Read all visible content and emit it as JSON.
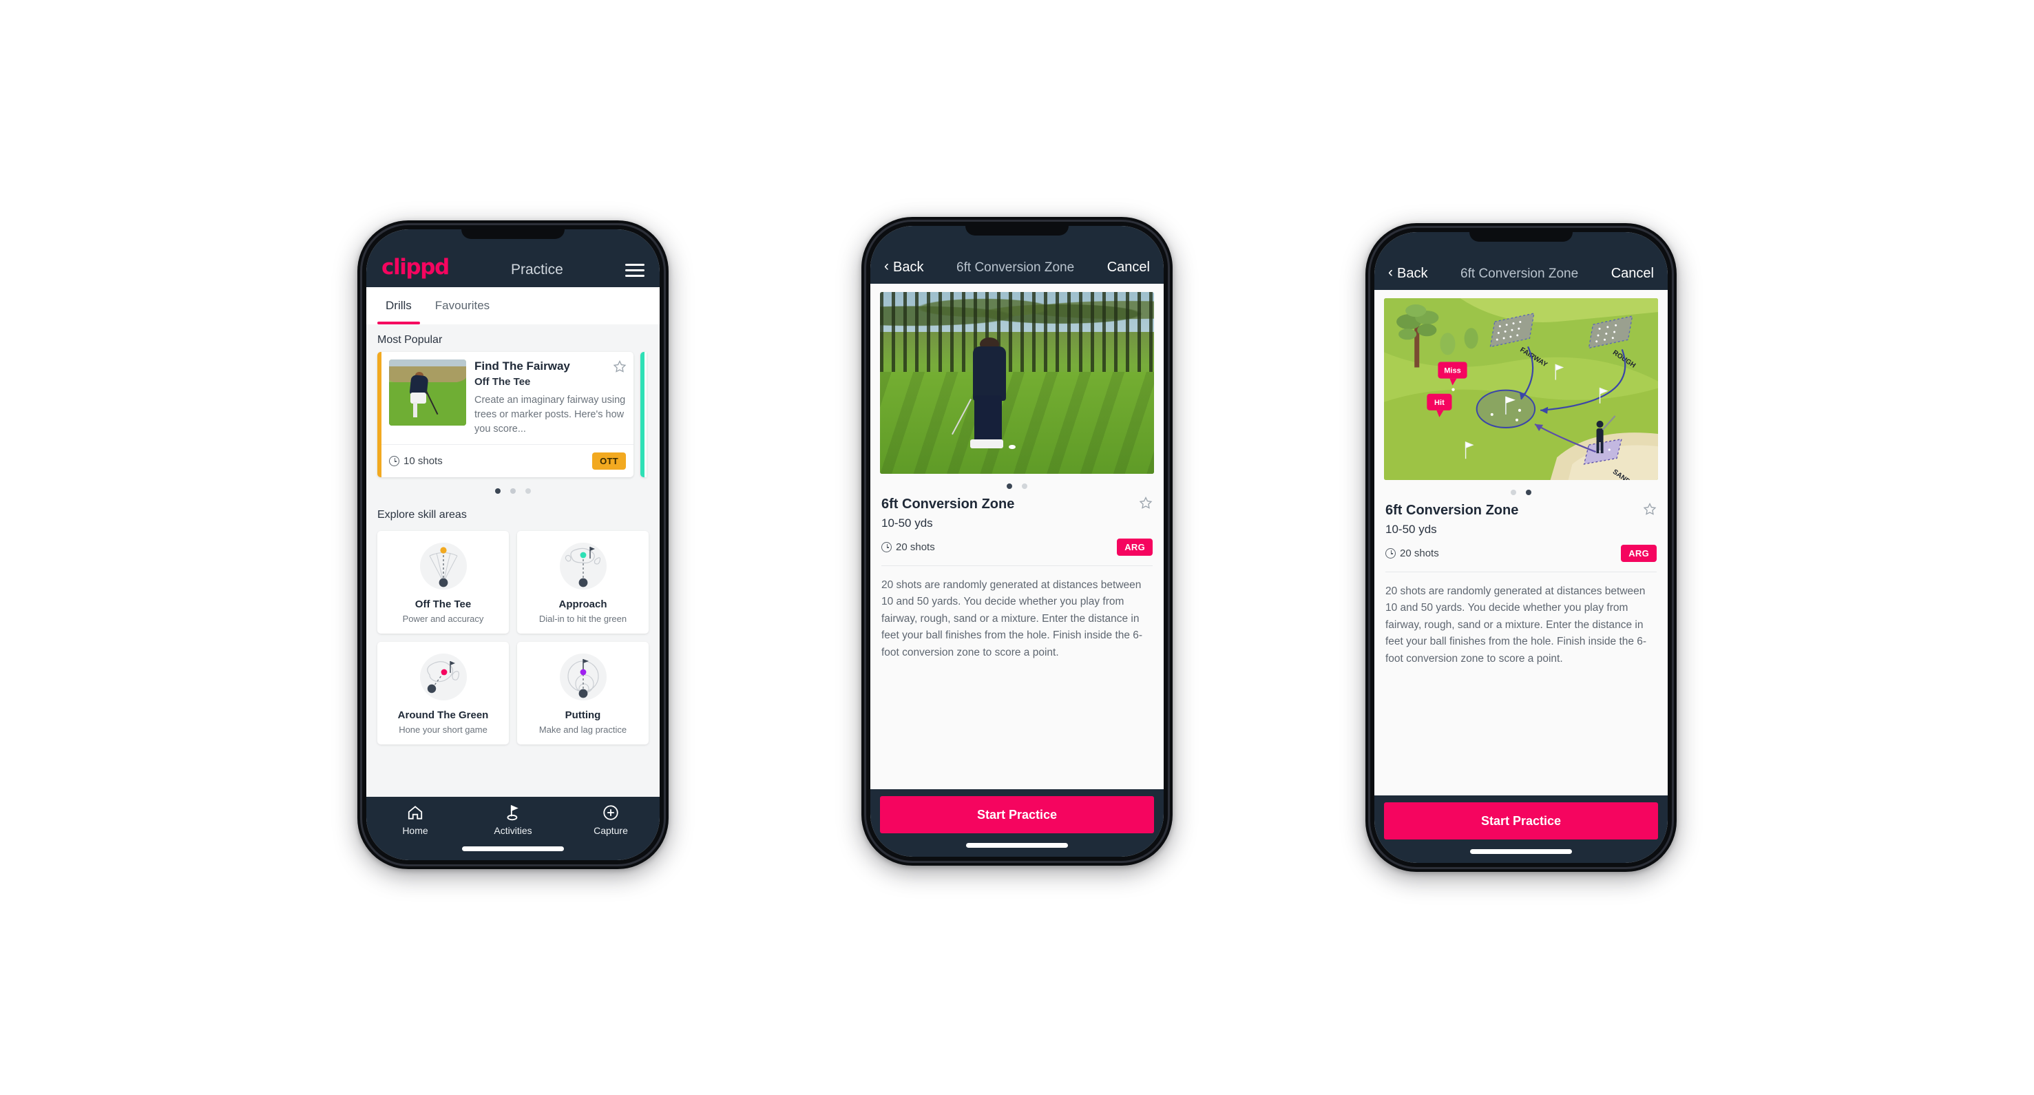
{
  "app": {
    "logo_text": "clippd",
    "brand_pink": "#f5055f",
    "header_navy": "#1e2b39"
  },
  "screen1": {
    "nav": {
      "logo": "clippd",
      "title": "Practice",
      "menu_icon": "hamburger-icon"
    },
    "tabs": [
      {
        "label": "Drills",
        "active": true
      },
      {
        "label": "Favourites",
        "active": false
      }
    ],
    "most_popular": {
      "section_label": "Most Popular",
      "card": {
        "title": "Find The Fairway",
        "subtitle": "Off The Tee",
        "description": "Create an imaginary fairway using trees or marker posts. Here's how you score...",
        "shots": "10 shots",
        "badge": "OTT",
        "badge_color": "#f2a920",
        "accent_color": "#f2a920",
        "favourite_icon": "star-outline-icon"
      },
      "peek_accent_color": "#2ee0b5",
      "dots": [
        true,
        false,
        false
      ]
    },
    "explore": {
      "section_label": "Explore skill areas",
      "skills": [
        {
          "name": "Off The Tee",
          "caption": "Power and accuracy",
          "icon": "tee-dispersion-icon",
          "dot_color": "#f2a920"
        },
        {
          "name": "Approach",
          "caption": "Dial-in to hit the green",
          "icon": "approach-green-icon",
          "dot_color": "#2ee0b5"
        },
        {
          "name": "Around The Green",
          "caption": "Hone your short game",
          "icon": "chip-green-icon",
          "dot_color": "#f5055f"
        },
        {
          "name": "Putting",
          "caption": "Make and lag practice",
          "icon": "putting-rings-icon",
          "dot_color": "#a020f0"
        }
      ]
    },
    "tabbar": [
      {
        "label": "Home",
        "icon": "home-icon",
        "active": false
      },
      {
        "label": "Activities",
        "icon": "golf-flag-icon",
        "active": true
      },
      {
        "label": "Capture",
        "icon": "plus-circle-icon",
        "active": false
      }
    ]
  },
  "screen2": {
    "nav": {
      "back": "Back",
      "title": "6ft Conversion Zone",
      "cancel": "Cancel",
      "back_icon": "chevron-left-icon"
    },
    "media": {
      "kind": "photo",
      "alt": "golfer-chipping-photo"
    },
    "dots": [
      true,
      false
    ],
    "detail": {
      "title": "6ft Conversion Zone",
      "yards": "10-50 yds",
      "shots": "20 shots",
      "badge": "ARG",
      "badge_color": "#f5055f",
      "favourite_icon": "star-outline-icon",
      "description": "20 shots are randomly generated at distances between 10 and 50 yards. You decide whether you play from fairway, rough, sand or a mixture. Enter the distance in feet your ball finishes from the hole. Finish inside the 6-foot conversion zone to score a point."
    },
    "cta": "Start Practice"
  },
  "screen3": {
    "nav": {
      "back": "Back",
      "title": "6ft Conversion Zone",
      "cancel": "Cancel",
      "back_icon": "chevron-left-icon"
    },
    "media": {
      "kind": "course-map",
      "alt": "golf-course-diagram",
      "labels": [
        "FAIRWAY",
        "ROUGH",
        "SAND"
      ],
      "markers": [
        "Miss",
        "Hit"
      ],
      "marker_color": "#f5055f"
    },
    "dots": [
      false,
      true
    ],
    "detail": {
      "title": "6ft Conversion Zone",
      "yards": "10-50 yds",
      "shots": "20 shots",
      "badge": "ARG",
      "badge_color": "#f5055f",
      "favourite_icon": "star-outline-icon",
      "description": "20 shots are randomly generated at distances between 10 and 50 yards. You decide whether you play from fairway, rough, sand or a mixture. Enter the distance in feet your ball finishes from the hole. Finish inside the 6-foot conversion zone to score a point."
    },
    "cta": "Start Practice"
  }
}
